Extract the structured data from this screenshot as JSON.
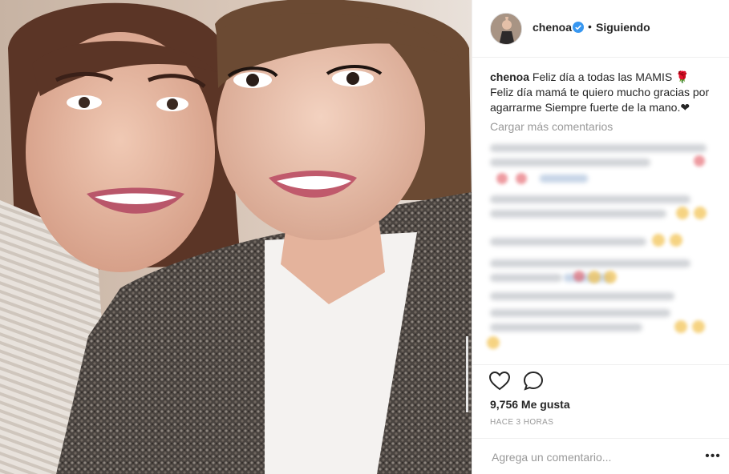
{
  "post": {
    "username": "chenoa",
    "verified_icon": "verified-badge-icon",
    "separator": "•",
    "follow_status": "Siguiendo",
    "caption": {
      "user": "chenoa",
      "line1": "Feliz día a todas las MAMIS 🌹",
      "line2": "Feliz día mamá te quiero mucho gracias por agarrarme Siempre fuerte de la mano.❤"
    },
    "load_more": "Cargar más comentarios",
    "likes": "9,756 Me gusta",
    "time": "HACE 3 HORAS",
    "comment_placeholder": "Agrega un comentario...",
    "more_label": "•••",
    "icons": {
      "like": "heart-icon",
      "comment": "comment-icon",
      "more": "more-options-icon"
    },
    "colors": {
      "text": "#262626",
      "muted": "#999999",
      "verified": "#3897f0",
      "border": "#efefef"
    }
  }
}
